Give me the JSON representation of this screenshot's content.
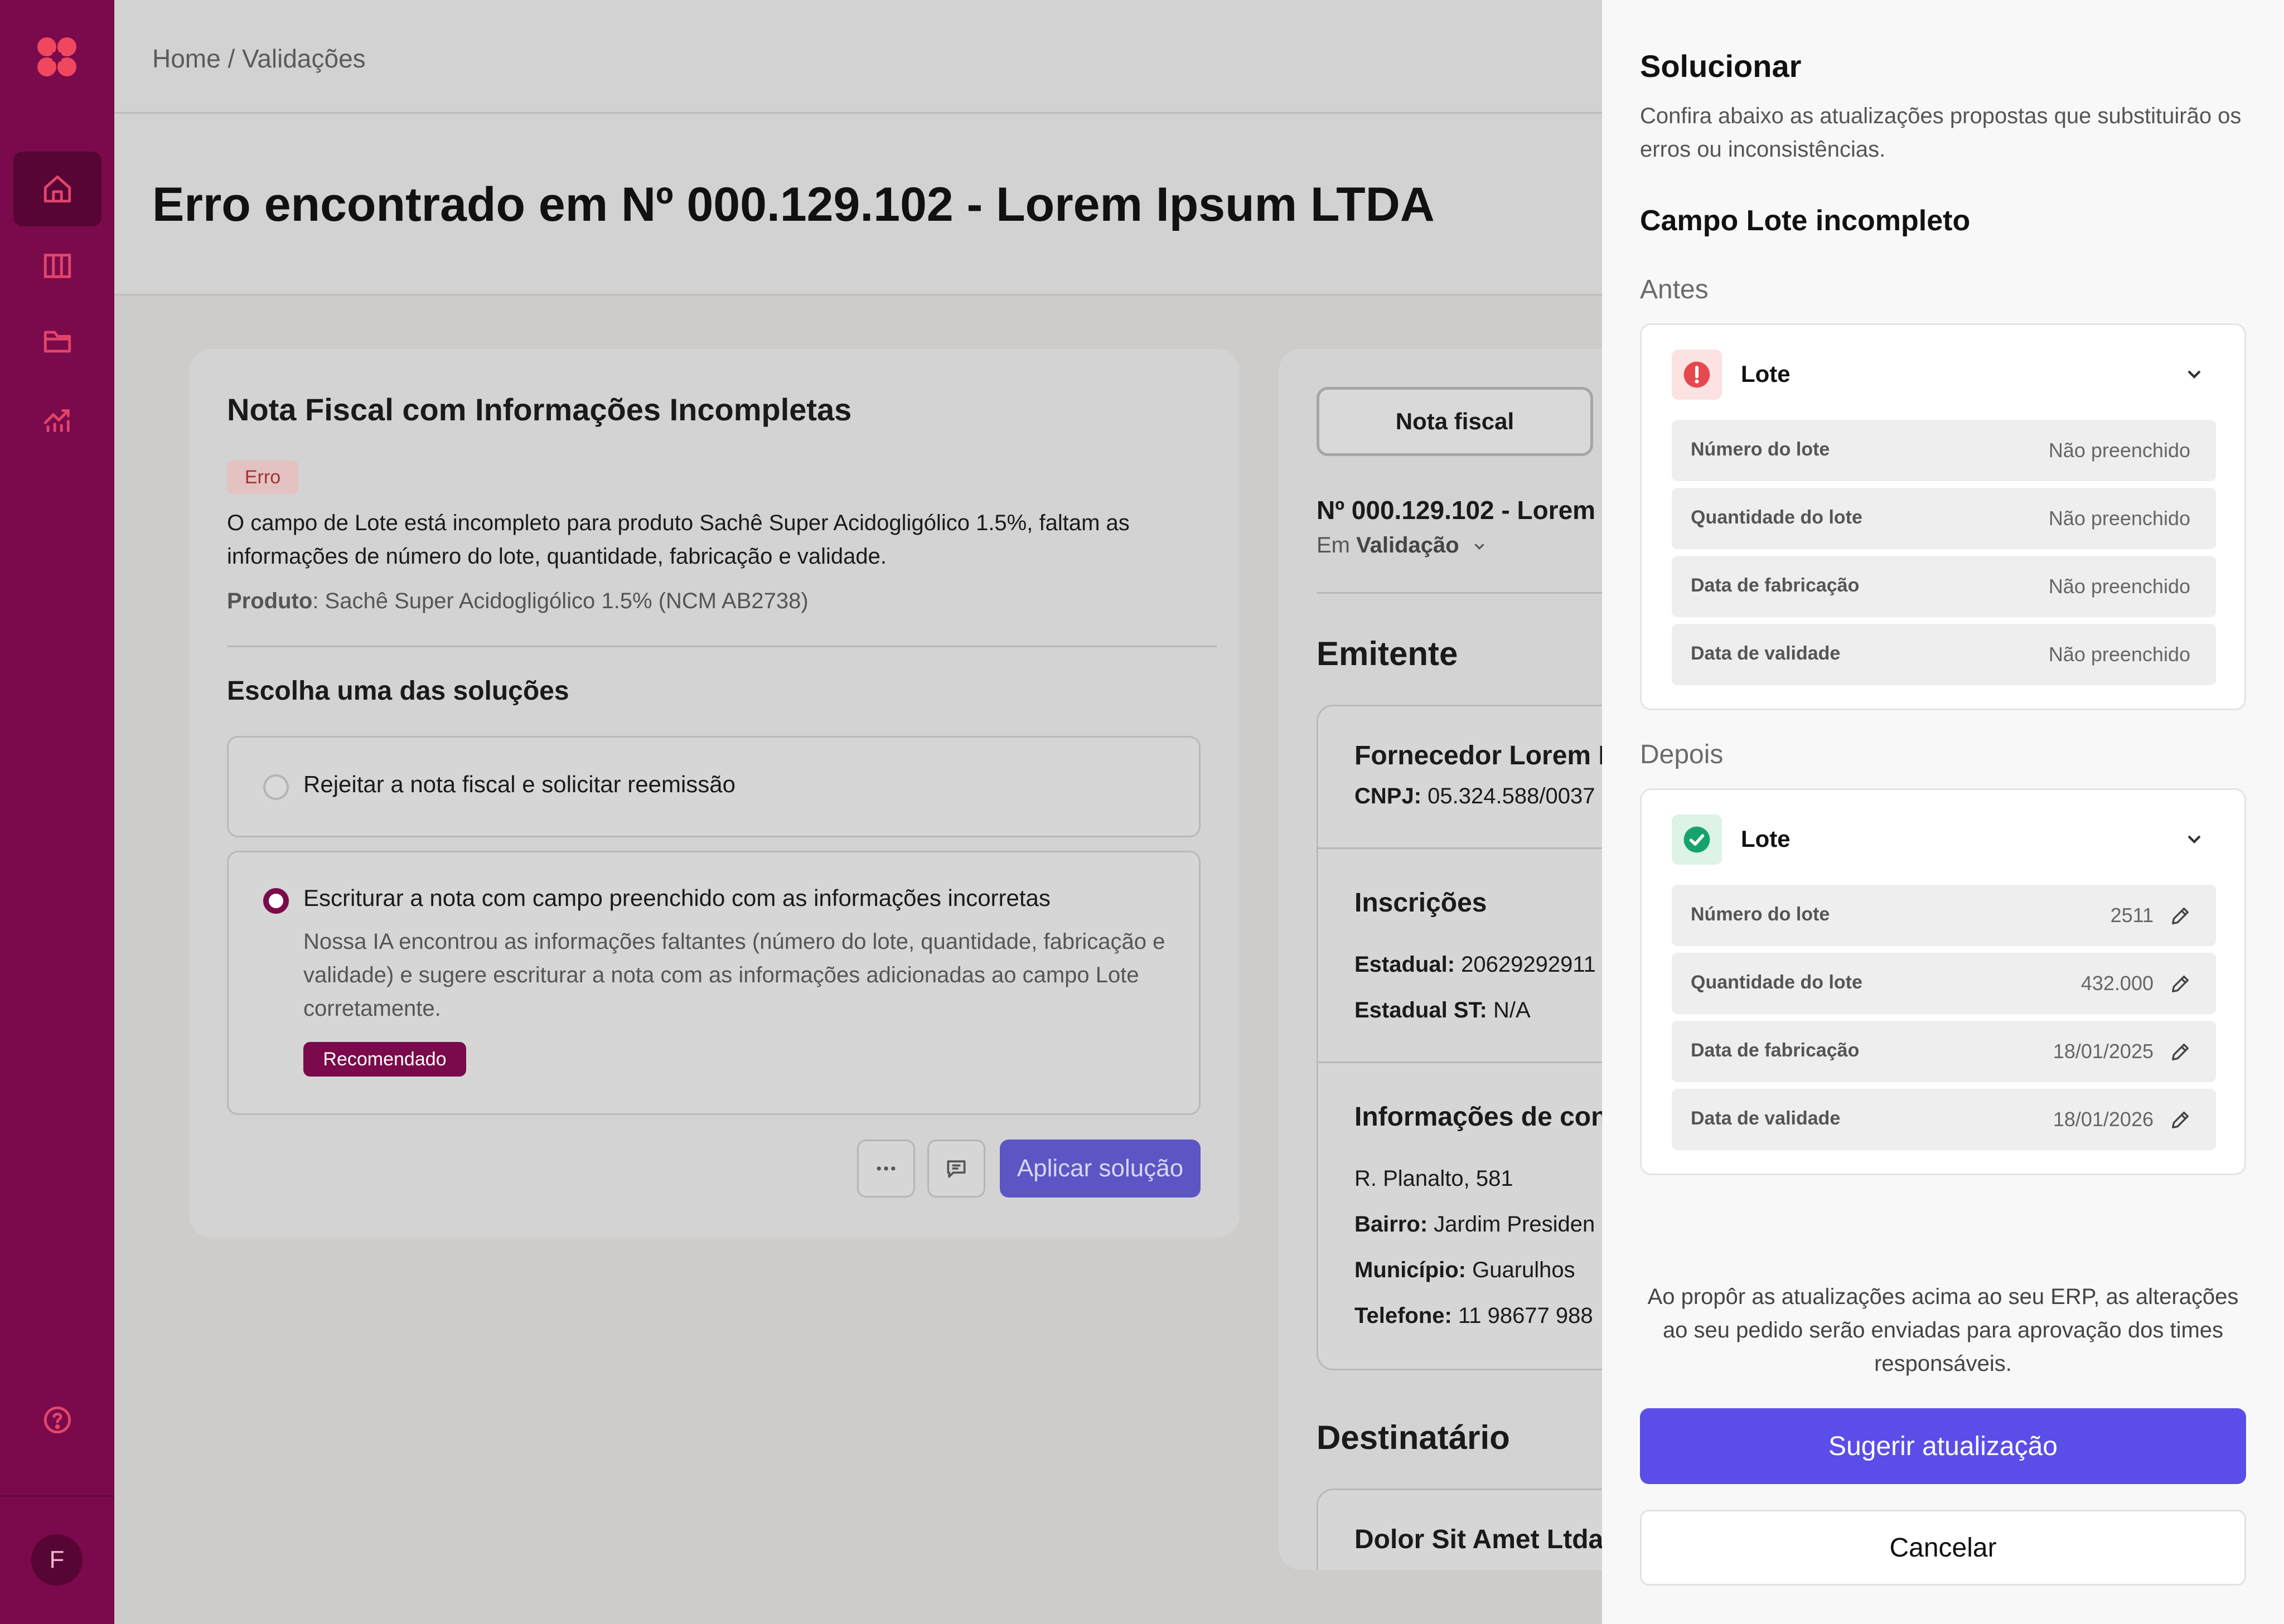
{
  "sidebar": {
    "nav": [
      "home-icon",
      "columns-icon",
      "folder-icon",
      "chart-icon"
    ],
    "help_icon": "help-icon",
    "avatar_initial": "F"
  },
  "breadcrumb": "Home / Validações",
  "page_title": "Erro encontrado em Nº 000.129.102 - Lorem Ipsum LTDA",
  "card": {
    "title": "Nota Fiscal com Informações Incompletas",
    "badge": "Erro",
    "description": "O campo de Lote está incompleto para produto Sachê Super Acidogligólico 1.5%, faltam as informações de número do lote, quantidade, fabricação e validade.",
    "product_label": "Produto",
    "product_value": ": Sachê Super Acidogligólico 1.5% (NCM AB2738)",
    "solutions_title": "Escolha uma das soluções",
    "option1": "Rejeitar a nota fiscal e solicitar reemissão",
    "option2": "Escriturar a nota com campo preenchido com as informações incorretas",
    "option2_desc": "Nossa IA encontrou as informações faltantes (número do lote, quantidade, fabricação e validade) e sugere escriturar a nota com as informações adicionadas ao campo Lote corretamente.",
    "recommended": "Recomendado",
    "apply": "Aplicar solução"
  },
  "detail": {
    "tab": "Nota fiscal",
    "number": "Nº 000.129.102 - Lorem",
    "status_prefix": "Em ",
    "status": "Validação",
    "emitente_title": "Emitente",
    "supplier": "Fornecedor Lorem Ip",
    "cnpj_label": "CNPJ:",
    "cnpj_value": " 05.324.588/0037",
    "inscricoes_title": "Inscrições",
    "estadual_label": "Estadual:",
    "estadual_value": " 20629292911",
    "estadual_st_label": "Estadual ST:",
    "estadual_st_value": " N/A",
    "contato_title": "Informações de cont",
    "address": "R. Planalto, 581",
    "bairro_label": "Bairro:",
    "bairro_value": " Jardim Presiden",
    "municipio_label": "Município:",
    "municipio_value": " Guarulhos",
    "telefone_label": "Telefone:",
    "telefone_value": " 11 98677 988",
    "destinatario_title": "Destinatário",
    "recipient": "Dolor Sit Amet Ltda"
  },
  "panel": {
    "title": "Solucionar",
    "subtitle": "Confira abaixo as atualizações propostas que substituirão os erros ou inconsistências.",
    "section": "Campo Lote incompleto",
    "before_label": "Antes",
    "after_label": "Depois",
    "field_name": "Lote",
    "before_rows": [
      {
        "label": "Número do lote",
        "value": "Não preenchido"
      },
      {
        "label": "Quantidade do lote",
        "value": "Não preenchido"
      },
      {
        "label": "Data de fabricação",
        "value": "Não preenchido"
      },
      {
        "label": "Data de validade",
        "value": "Não preenchido"
      }
    ],
    "after_rows": [
      {
        "label": "Número do lote",
        "value": "2511"
      },
      {
        "label": "Quantidade do lote",
        "value": "432.000"
      },
      {
        "label": "Data de fabricação",
        "value": "18/01/2025"
      },
      {
        "label": "Data de validade",
        "value": "18/01/2026"
      }
    ],
    "note": "Ao propôr as atualizações acima ao seu ERP, as alterações ao seu pedido serão enviadas para aprovação dos times responsáveis.",
    "primary": "Sugerir atualização",
    "secondary": "Cancelar"
  },
  "colors": {
    "brand": "#7a0a4b",
    "primary": "#5b4de8",
    "error": "#e5484d",
    "success": "#16a36a"
  }
}
